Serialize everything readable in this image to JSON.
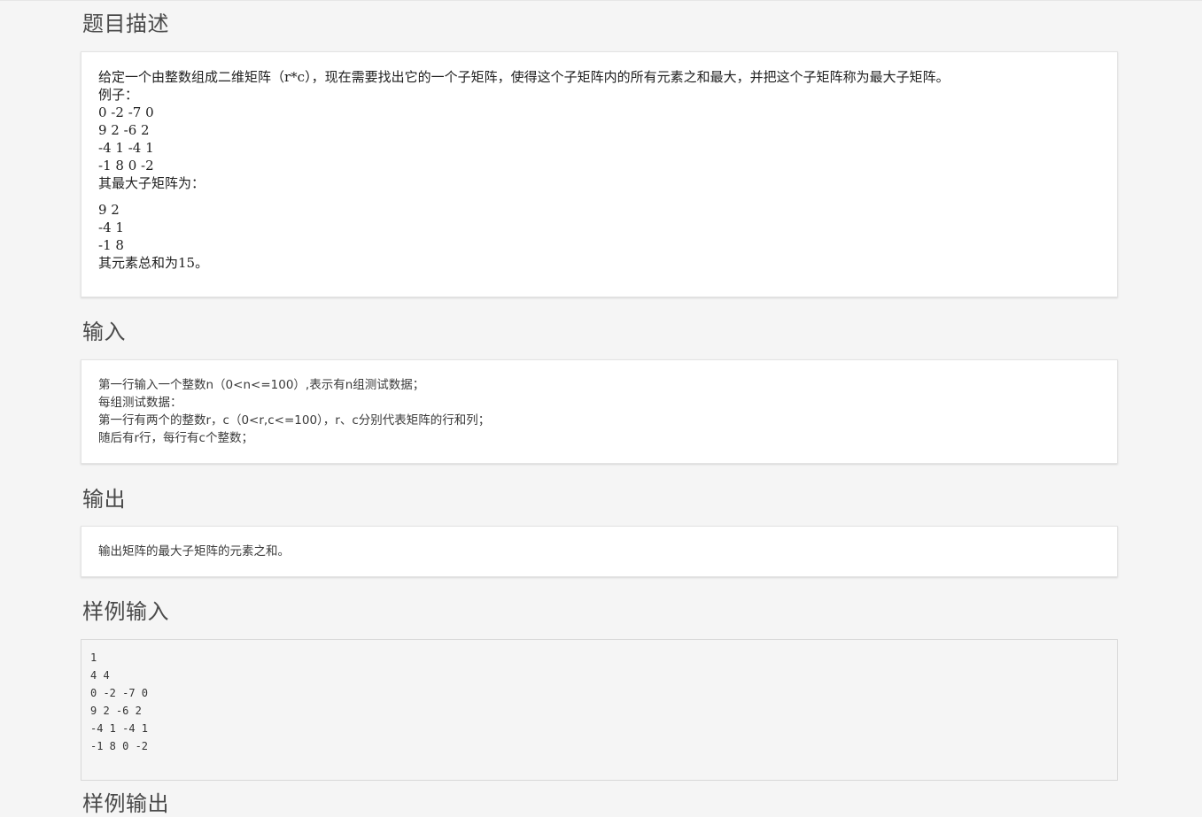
{
  "description": {
    "title": "题目描述",
    "lines": [
      "给定一个由整数组成二维矩阵（r*c），现在需要找出它的一个子矩阵，使得这个子矩阵内的所有元素之和最大，并把这个子矩阵称为最大子矩阵。",
      "例子：",
      "0 -2 -7 0",
      "9 2 -6 2",
      "-4 1 -4 1",
      "-1 8 0 -2",
      "其最大子矩阵为：",
      "9 2",
      "-4 1",
      "-1 8",
      "其元素总和为15。"
    ]
  },
  "input": {
    "title": "输入",
    "lines": [
      "第一行输入一个整数n（0<n<=100）,表示有n组测试数据；",
      "每组测试数据：",
      "第一行有两个的整数r，c（0<r,c<=100），r、c分别代表矩阵的行和列；",
      "随后有r行，每行有c个整数；"
    ]
  },
  "output": {
    "title": "输出",
    "lines": [
      "输出矩阵的最大子矩阵的元素之和。"
    ]
  },
  "sample_input": {
    "title": "样例输入",
    "lines": [
      "1",
      "4 4",
      "0 -2 -7 0",
      "9 2 -6 2",
      "-4 1 -4 1",
      "-1 8 0 -2"
    ]
  },
  "sample_output": {
    "title": "样例输出"
  }
}
